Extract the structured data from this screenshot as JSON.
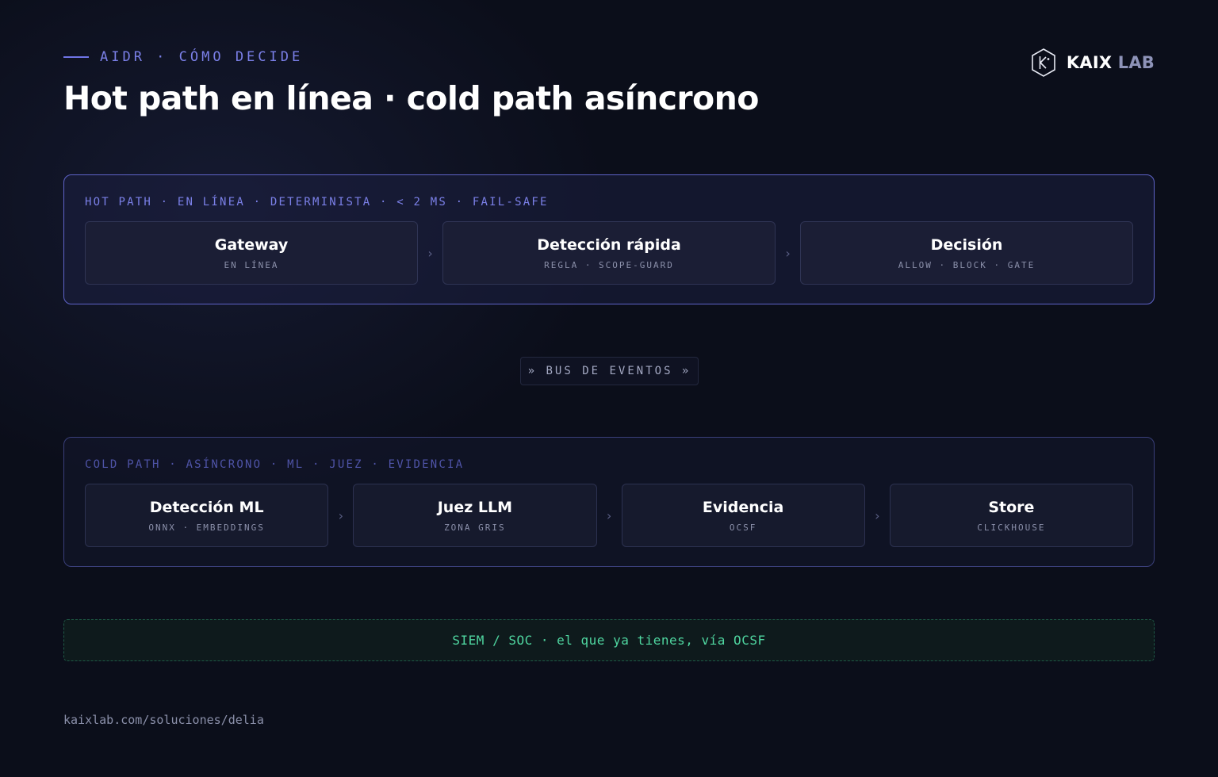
{
  "header": {
    "eyebrow": "AIDR · CÓMO DECIDE",
    "title": "Hot path en línea · cold path asíncrono"
  },
  "brand": {
    "name": "KAIX",
    "suffix": "LAB",
    "logo_icon": "hexagon-k-icon"
  },
  "hot_path": {
    "label": "HOT PATH · EN LÍNEA · DETERMINISTA · < 2 MS · FAIL-SAFE",
    "separator": "›",
    "nodes": [
      {
        "title": "Gateway",
        "subtitle": "EN LÍNEA"
      },
      {
        "title": "Detección rápida",
        "subtitle": "REGLA · SCOPE-GUARD"
      },
      {
        "title": "Decisión",
        "subtitle": "ALLOW · BLOCK · GATE"
      }
    ]
  },
  "bus": {
    "label": "» BUS DE EVENTOS »"
  },
  "cold_path": {
    "label": "COLD PATH · ASÍNCRONO · ML · JUEZ · EVIDENCIA",
    "separator": "›",
    "nodes": [
      {
        "title": "Detección ML",
        "subtitle": "ONNX · EMBEDDINGS"
      },
      {
        "title": "Juez LLM",
        "subtitle": "ZONA GRIS"
      },
      {
        "title": "Evidencia",
        "subtitle": "OCSF"
      },
      {
        "title": "Store",
        "subtitle": "CLICKHOUSE"
      }
    ]
  },
  "siem": {
    "label": "SIEM / SOC · el que ya tienes, vía OCSF"
  },
  "footer": {
    "url": "kaixlab.com/soluciones/delia"
  },
  "colors": {
    "background": "#0b0e1a",
    "accent": "#7b80e8",
    "hot_border": "#5e63c8",
    "cold_border": "#3a3f7a",
    "siem_text": "#4fd6a0"
  }
}
